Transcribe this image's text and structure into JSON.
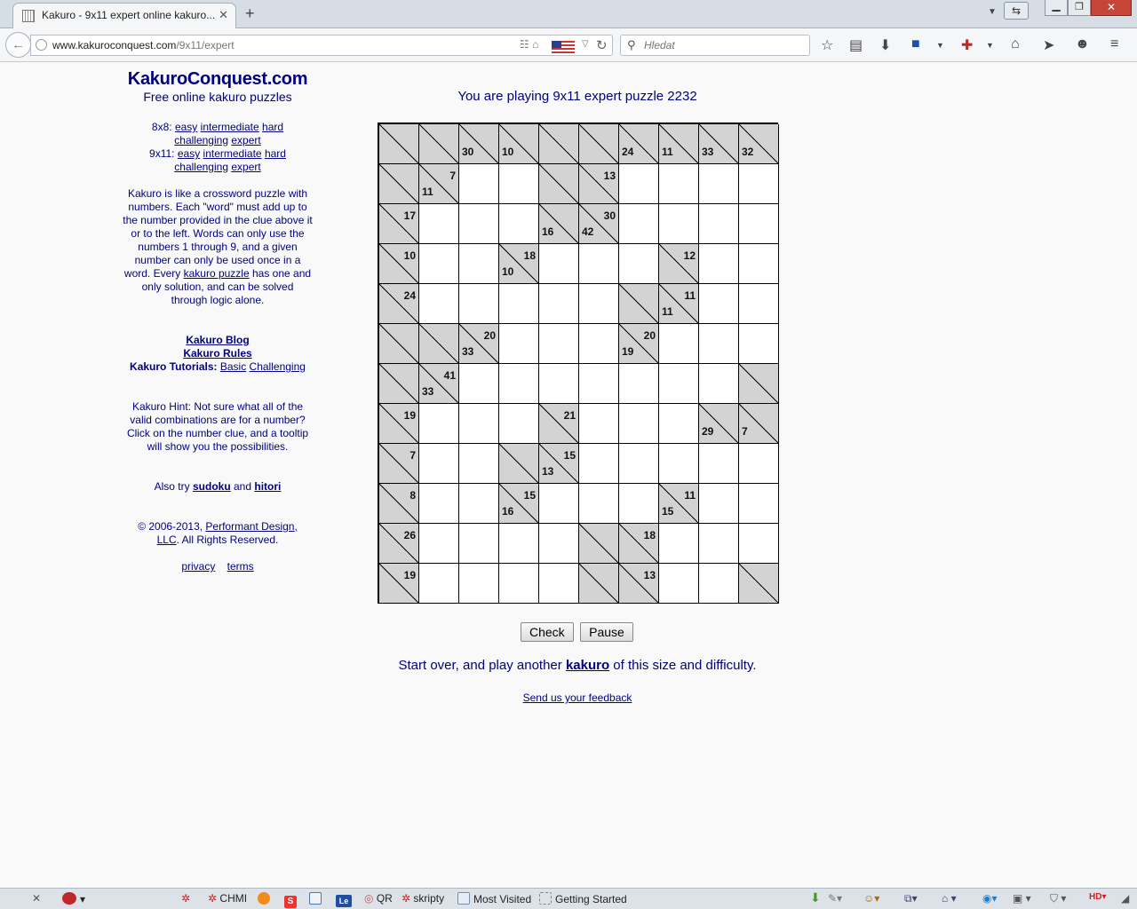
{
  "browser": {
    "tab_title": "Kakuro - 9x11 expert online kakuro...",
    "url_host": "www.kakuroconquest.com",
    "url_path": "/9x11/expert",
    "search_placeholder": "Hledat"
  },
  "sidebar": {
    "site_title": "KakuroConquest.com",
    "site_subtitle": "Free online kakuro puzzles",
    "levels_8x8_label": "8x8:",
    "levels_9x11_label": "9x11:",
    "level_links": [
      "easy",
      "intermediate",
      "hard",
      "challenging",
      "expert"
    ],
    "intro_before": "Kakuro is like a crossword puzzle with numbers. Each \"word\" must add up to the number provided in the clue above it or to the left. Words can only use the numbers 1 through 9, and a given number can only be used once in a word. Every ",
    "intro_link": "kakuro puzzle",
    "intro_after": " has one and only solution, and can be solved through logic alone.",
    "blog_link": "Kakuro Blog",
    "rules_link": "Kakuro Rules",
    "tutorials_label": "Kakuro Tutorials:",
    "tutorial_basic": "Basic",
    "tutorial_challenging": "Challenging",
    "hint": "Kakuro Hint: Not sure what all of the valid combinations are for a number? Click on the number clue, and a tooltip will show you the possibilities.",
    "also_try": "Also try",
    "sudoku_link": "sudoku",
    "and_word": "and",
    "hitori_link": "hitori",
    "copyright_prefix": "© 2006-2013, ",
    "copyright_link": "Performant Design, LLC",
    "copyright_suffix": ". All Rights Reserved.",
    "privacy_link": "privacy",
    "terms_link": "terms"
  },
  "main": {
    "heading": "You are playing 9x11 expert puzzle 2232",
    "check_button": "Check",
    "pause_button": "Pause",
    "start_over_before": "Start over, and play another ",
    "start_over_link": "kakuro",
    "start_over_after": " of this size and difficulty.",
    "feedback_link": "Send us your feedback"
  },
  "puzzle": {
    "cols": 10,
    "rows": 12,
    "grid": [
      [
        "B",
        "B",
        "B,30",
        "B,10",
        "B",
        "B",
        "B,24",
        "B,11",
        "B,33",
        "B,32"
      ],
      [
        "B",
        "B7,11",
        "W",
        "W",
        "B",
        "B13",
        "W",
        "W",
        "W",
        "W"
      ],
      [
        "B17",
        "W",
        "W",
        "W",
        "B,16",
        "B30,42",
        "W",
        "W",
        "W",
        "W"
      ],
      [
        "B10",
        "W",
        "W",
        "B18,10",
        "W",
        "W",
        "W",
        "B12",
        "W",
        "W"
      ],
      [
        "B24",
        "W",
        "W",
        "W",
        "W",
        "W",
        "B",
        "B11,11",
        "W",
        "W"
      ],
      [
        "B",
        "B",
        "B20,33",
        "W",
        "W",
        "W",
        "B20,19",
        "W",
        "W",
        "W"
      ],
      [
        "B",
        "B41,33",
        "W",
        "W",
        "W",
        "W",
        "W",
        "W",
        "W",
        "B"
      ],
      [
        "B19",
        "W",
        "W",
        "W",
        "B21",
        "W",
        "W",
        "W",
        "B,29",
        "B,7"
      ],
      [
        "B7",
        "W",
        "W",
        "B",
        "B15,13",
        "W",
        "W",
        "W",
        "W",
        "W"
      ],
      [
        "B8",
        "W",
        "W",
        "B15,16",
        "W",
        "W",
        "W",
        "B11,15",
        "W",
        "W"
      ],
      [
        "B26",
        "W",
        "W",
        "W",
        "W",
        "B",
        "B18",
        "W",
        "W",
        "W"
      ],
      [
        "B19",
        "W",
        "W",
        "W",
        "W",
        "B",
        "B13",
        "W",
        "W",
        "B"
      ]
    ]
  },
  "addon_bar": {
    "items": [
      "CHMI",
      "QR",
      "skripty",
      "Most Visited",
      "Getting Started"
    ]
  },
  "colors": {
    "text_navy": "#000080",
    "clue_cell": "#d3d3d3",
    "page_bg": "#f9f9f9"
  }
}
